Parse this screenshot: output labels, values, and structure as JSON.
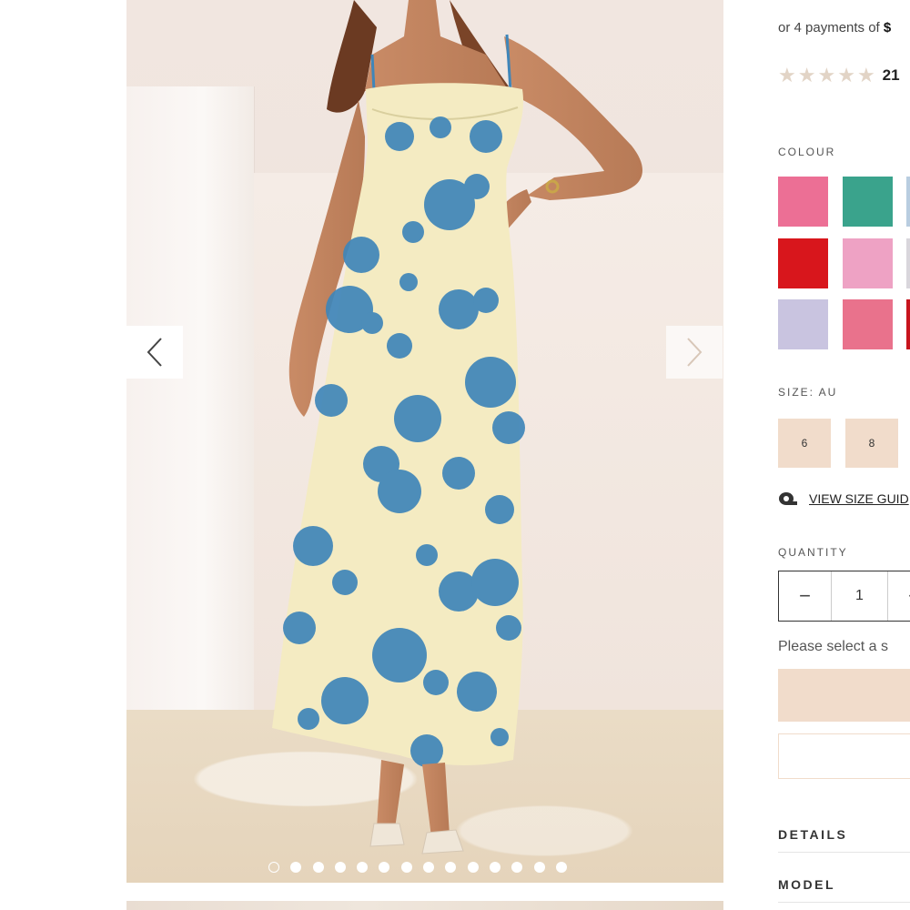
{
  "pricing": {
    "payments_prefix": "or 4 payments of",
    "payments_amount": "$"
  },
  "rating": {
    "stars": 5,
    "review_count": "21"
  },
  "colour": {
    "label": "COLOUR",
    "swatches": [
      {
        "name": "pink-floral",
        "color": "#ec6f95"
      },
      {
        "name": "green-floral",
        "color": "#3aa38c"
      },
      {
        "name": "blue-partial",
        "color": "#b9cde0"
      },
      {
        "name": "red",
        "color": "#d8161c"
      },
      {
        "name": "light-pink",
        "color": "#eea2c4"
      },
      {
        "name": "grey-partial",
        "color": "#d9d6dc"
      },
      {
        "name": "lilac-floral",
        "color": "#c9c4e0"
      },
      {
        "name": "pink-red-floral",
        "color": "#e9728c"
      },
      {
        "name": "red-partial",
        "color": "#c7141d"
      }
    ]
  },
  "size": {
    "label": "SIZE: AU",
    "options": [
      "6",
      "8"
    ],
    "guide_label": "VIEW SIZE GUID"
  },
  "quantity": {
    "label": "QUANTITY",
    "minus": "−",
    "value": "1",
    "plus": "+"
  },
  "hint": "Please select a s",
  "accordions": [
    "DETAILS",
    "MODEL"
  ],
  "gallery": {
    "image_count": 14,
    "active_index": 0
  },
  "colors": {
    "accent_beige": "#f1dccb",
    "dress_base": "#f4ebc2",
    "dress_print": "#3f86b9"
  }
}
